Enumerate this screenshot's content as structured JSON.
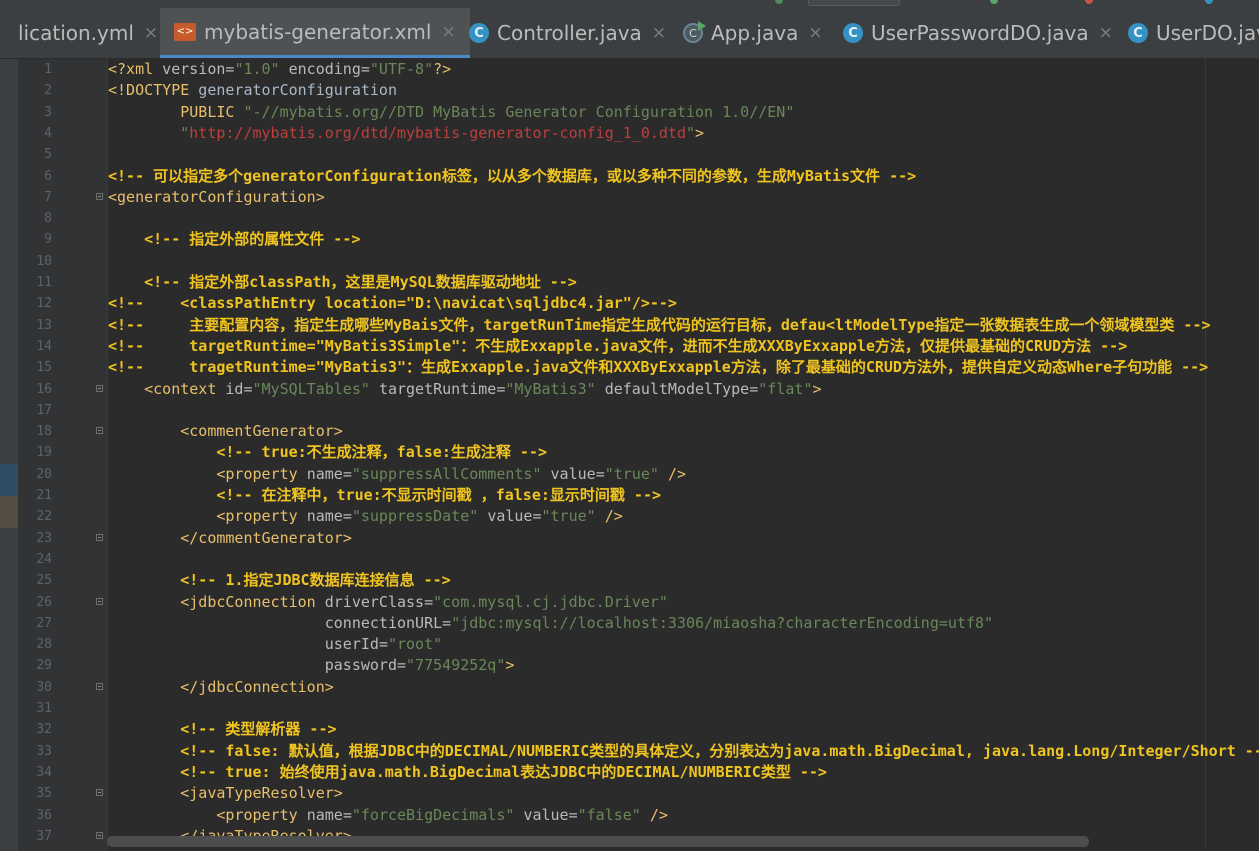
{
  "tabs": [
    {
      "label": "lication.yml",
      "icon": "yml-icon",
      "active": false
    },
    {
      "label": "mybatis-generator.xml",
      "icon": "xml-icon",
      "active": true
    },
    {
      "label": "Controller.java",
      "icon": "class-icon",
      "active": false
    },
    {
      "label": "App.java",
      "icon": "app-class-icon",
      "active": false
    },
    {
      "label": "UserPasswordDO.java",
      "icon": "class-icon",
      "active": false
    },
    {
      "label": "UserDO.jav",
      "icon": "class-icon",
      "active": false
    }
  ],
  "tab_close_glyph": "×",
  "lines": [
    {
      "n": "1",
      "t": "<?xml version=\"1.0\" encoding=\"UTF-8\"?>"
    },
    {
      "n": "2",
      "t": "<!DOCTYPE generatorConfiguration"
    },
    {
      "n": "3",
      "t": "        PUBLIC \"-//mybatis.org//DTD MyBatis Generator Configuration 1.0//EN\""
    },
    {
      "n": "4",
      "t": "        \"http://mybatis.org/dtd/mybatis-generator-config_1_0.dtd\">"
    },
    {
      "n": "5",
      "t": ""
    },
    {
      "n": "6",
      "t": "<!-- 可以指定多个generatorConfiguration标签，以从多个数据库，或以多种不同的参数，生成MyBatis文件 -->"
    },
    {
      "n": "7",
      "t": "<generatorConfiguration>"
    },
    {
      "n": "8",
      "t": ""
    },
    {
      "n": "9",
      "t": "    <!-- 指定外部的属性文件 -->"
    },
    {
      "n": "10",
      "t": ""
    },
    {
      "n": "11",
      "t": "    <!-- 指定外部classPath，这里是MySQL数据库驱动地址 -->"
    },
    {
      "n": "12",
      "t": "<!--    <classPathEntry location=\"D:\\navicat\\sqljdbc4.jar\"/>-->"
    },
    {
      "n": "13",
      "t": "<!--     主要配置内容，指定生成哪些MyBais文件，targetRunTime指定生成代码的运行目标，defau<ltModelType指定一张数据表生成一个领域模型类 -->"
    },
    {
      "n": "14",
      "t": "<!--     targetRuntime=\"MyBatis3Simple\"：不生成Exxapple.java文件，进而不生成XXXByExxapple方法，仅提供最基础的CRUD方法 -->"
    },
    {
      "n": "15",
      "t": "<!--     tragetRuntime=\"MyBatis3\"：生成Exxapple.java文件和XXXByExxapple方法，除了最基础的CRUD方法外，提供自定义动态Where子句功能 -->"
    },
    {
      "n": "16",
      "t": "    <context id=\"MySQLTables\" targetRuntime=\"MyBatis3\" defaultModelType=\"flat\">"
    },
    {
      "n": "17",
      "t": ""
    },
    {
      "n": "18",
      "t": "        <commentGenerator>"
    },
    {
      "n": "19",
      "t": "            <!-- true:不生成注释，false:生成注释 -->"
    },
    {
      "n": "20",
      "t": "            <property name=\"suppressAllComments\" value=\"true\" />"
    },
    {
      "n": "21",
      "t": "            <!-- 在注释中，true:不显示时间戳 ，false:显示时间戳 -->"
    },
    {
      "n": "22",
      "t": "            <property name=\"suppressDate\" value=\"true\" />"
    },
    {
      "n": "23",
      "t": "        </commentGenerator>"
    },
    {
      "n": "24",
      "t": ""
    },
    {
      "n": "25",
      "t": "        <!-- 1.指定JDBC数据库连接信息 -->"
    },
    {
      "n": "26",
      "t": "        <jdbcConnection driverClass=\"com.mysql.cj.jdbc.Driver\""
    },
    {
      "n": "27",
      "t": "                        connectionURL=\"jdbc:mysql://localhost:3306/miaosha?characterEncoding=utf8\""
    },
    {
      "n": "28",
      "t": "                        userId=\"root\""
    },
    {
      "n": "29",
      "t": "                        password=\"77549252q\">"
    },
    {
      "n": "30",
      "t": "        </jdbcConnection>"
    },
    {
      "n": "31",
      "t": ""
    },
    {
      "n": "32",
      "t": "        <!-- 类型解析器 -->"
    },
    {
      "n": "33",
      "t": "        <!-- false: 默认值，根据JDBC中的DECIMAL/NUMBERIC类型的具体定义，分别表达为java.math.BigDecimal, java.lang.Long/Integer/Short --"
    },
    {
      "n": "34",
      "t": "        <!-- true: 始终使用java.math.BigDecimal表达JDBC中的DECIMAL/NUMBERIC类型 -->"
    },
    {
      "n": "35",
      "t": "        <javaTypeResolver>"
    },
    {
      "n": "36",
      "t": "            <property name=\"forceBigDecimals\" value=\"false\" />"
    },
    {
      "n": "37",
      "t": "        </javaTypeResolver>"
    }
  ],
  "colors": {
    "background": "#2b2b2b",
    "tag": "#e8bf6a",
    "attribute_value": "#6a8759",
    "comment": "#f0c420",
    "text": "#a9b7c6"
  }
}
